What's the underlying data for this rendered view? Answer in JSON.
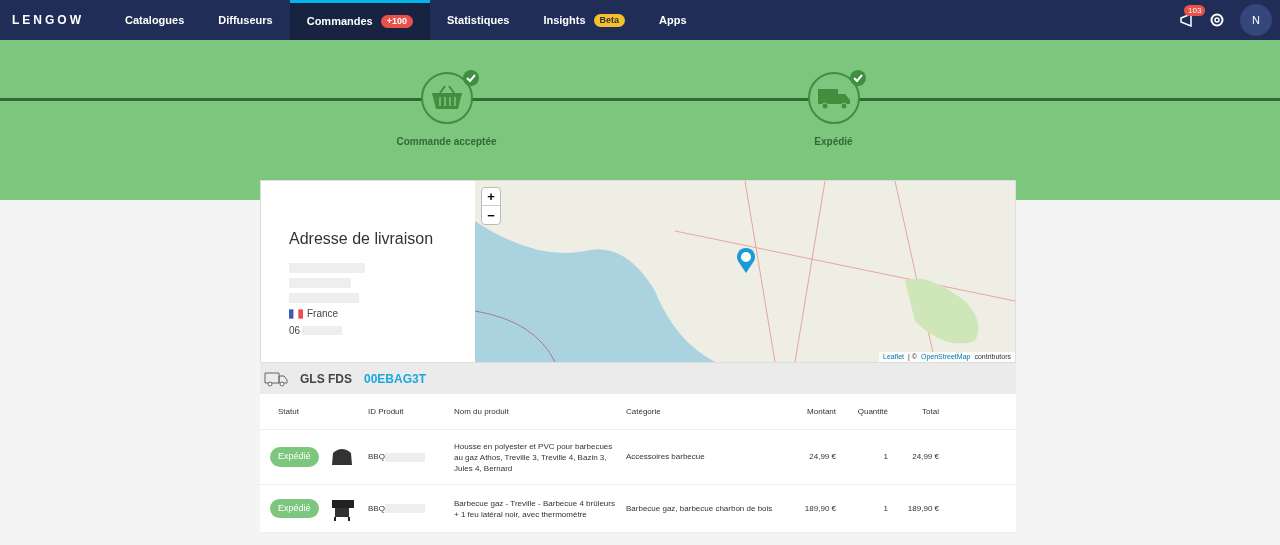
{
  "nav": {
    "logo": "LENGOW",
    "items": [
      {
        "label": "Catalogues",
        "selected": false
      },
      {
        "label": "Diffuseurs",
        "selected": false
      },
      {
        "label": "Commandes",
        "selected": true,
        "badge": "+100",
        "color": "#e8524a"
      },
      {
        "label": "Statistiques",
        "selected": false
      },
      {
        "label": "Insights",
        "selected": false,
        "badge": "Beta",
        "color": "#f5c02a"
      },
      {
        "label": "Apps",
        "selected": false
      }
    ],
    "notifications": "103",
    "avatar": "N"
  },
  "steps": [
    {
      "label": "Commande acceptée",
      "kind": "basket",
      "done": true
    },
    {
      "label": "Expédié",
      "kind": "truck",
      "done": true
    }
  ],
  "address": {
    "title": "Adresse de livraison",
    "country": "France",
    "phone": "06"
  },
  "map": {
    "zoom_in": "+",
    "zoom_out": "−",
    "attribution_link": "Leaflet",
    "attribution_sep": "| ©",
    "attribution_osm": "OpenStreetMap",
    "attribution_tail": "contributors"
  },
  "carrier": {
    "name": "GLS FDS",
    "tracking": "00EBAG3T"
  },
  "table": {
    "columns": [
      "Statut",
      "",
      "ID Produit",
      "Nom du produit",
      "Catégorie",
      "Montant",
      "Quantité",
      "Total"
    ],
    "rows": [
      {
        "status": "Expédié",
        "kind": "grill-cover",
        "id": "BBQ",
        "name": "Housse en polyester et PVC pour barbecues au gaz Athos, Treville 3, Treville 4, Bazin 3, Jules 4, Bernard",
        "category": "Accessoires barbecue",
        "amount": "24,99 €",
        "quantity": "1",
        "total": "24,99 €"
      },
      {
        "status": "Expédié",
        "kind": "gas-grill",
        "id": "BBQ",
        "name": "Barbecue gaz - Treville - Barbecue 4 brûleurs + 1 feu latéral noir, avec thermomètre",
        "category": "Barbecue gaz, barbecue charbon de bois",
        "amount": "189,90 €",
        "quantity": "1",
        "total": "189,90 €"
      }
    ]
  }
}
